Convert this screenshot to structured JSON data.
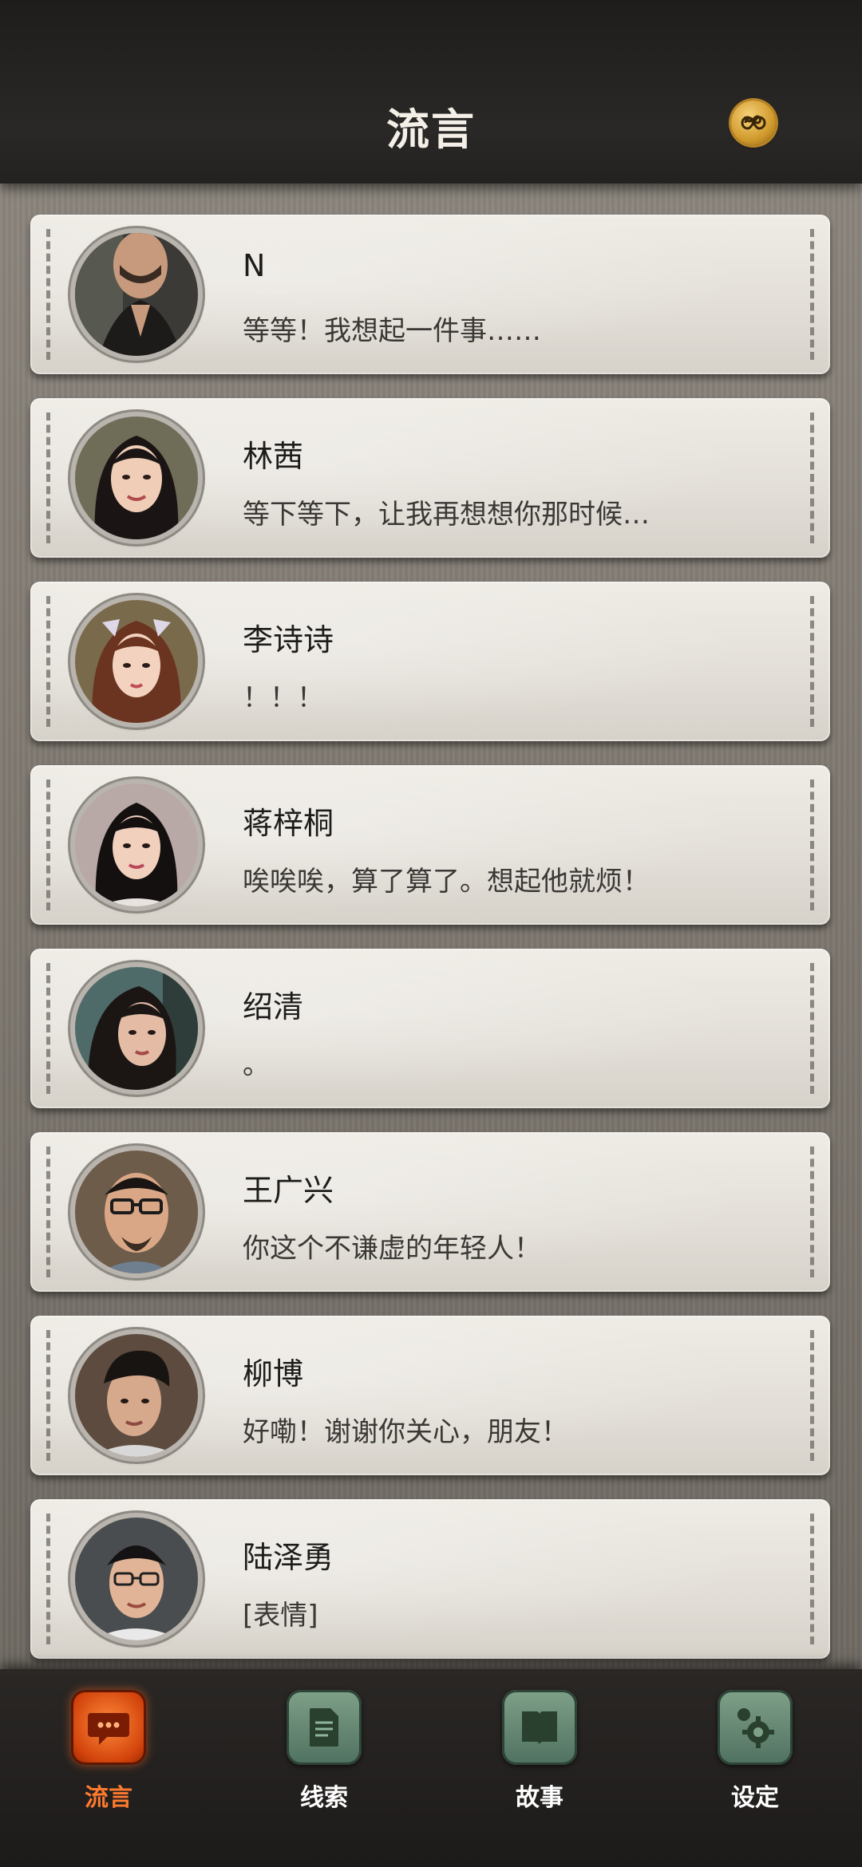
{
  "header": {
    "title": "流言",
    "coin_icon": "infinity-coin-icon"
  },
  "colors": {
    "header_bg": "#242220",
    "card_bg": "#e6e2db",
    "active_tab": "#ff7a2e",
    "inactive_tab": "#5f826e"
  },
  "contacts": [
    {
      "name": "N",
      "message": "等等！我想起一件事……"
    },
    {
      "name": "林茜",
      "message": "等下等下，让我再想想你那时候…"
    },
    {
      "name": "李诗诗",
      "message": "！！！"
    },
    {
      "name": "蒋梓桐",
      "message": "唉唉唉，算了算了。想起他就烦！"
    },
    {
      "name": "绍清",
      "message": "。"
    },
    {
      "name": "王广兴",
      "message": "你这个不谦虚的年轻人！"
    },
    {
      "name": "柳博",
      "message": "好嘞！谢谢你关心，朋友！"
    },
    {
      "name": "陆泽勇",
      "message": "[表情]"
    }
  ],
  "nav": {
    "items": [
      {
        "label": "流言",
        "icon": "chat-bubble-icon",
        "active": true
      },
      {
        "label": "线索",
        "icon": "document-icon",
        "active": false
      },
      {
        "label": "故事",
        "icon": "book-icon",
        "active": false
      },
      {
        "label": "设定",
        "icon": "gear-icon",
        "active": false
      }
    ]
  }
}
